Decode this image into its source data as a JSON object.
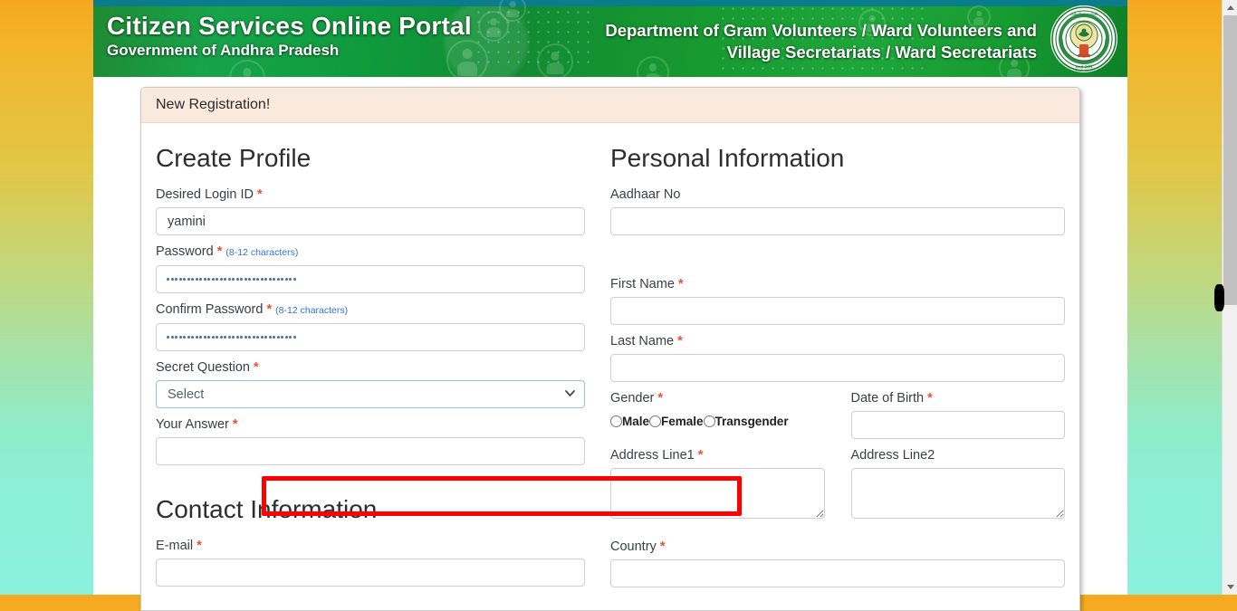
{
  "banner": {
    "title_line1": "Citizen Services Online Portal",
    "title_line2": "Government of Andhra Pradesh",
    "dept_line1": "Department of Gram Volunteers / Ward Volunteers and",
    "dept_line2": "Village Secretariats / Ward Secretariats",
    "emblem_name": "andhra-pradesh-state-emblem",
    "colors": {
      "green_dark": "#0f7f27",
      "green_mid": "#17a34a",
      "top_strip": "#0b7c8c"
    }
  },
  "panel": {
    "header_title": "New Registration!"
  },
  "create_profile": {
    "heading": "Create Profile",
    "fields": {
      "login_id": {
        "label": "Desired Login ID",
        "required": true,
        "value": "yamini",
        "placeholder": ""
      },
      "password": {
        "label": "Password",
        "required": true,
        "hint": "(8-12 characters)",
        "masked_value": "································",
        "mask_char_count": 32
      },
      "confirm_password": {
        "label": "Confirm Password",
        "required": true,
        "hint": "(8-12 characters)",
        "masked_value": "································",
        "mask_char_count": 32
      },
      "secret_question": {
        "label": "Secret Question",
        "required": true,
        "selected": "Select",
        "options": [
          "Select"
        ],
        "focused": true,
        "highlighted": true
      },
      "your_answer": {
        "label": "Your Answer",
        "required": true,
        "value": "",
        "placeholder": ""
      }
    }
  },
  "contact_information": {
    "heading": "Contact Information",
    "fields": {
      "email": {
        "label": "E-mail",
        "required": true,
        "value": "",
        "placeholder": ""
      }
    }
  },
  "personal_information": {
    "heading": "Personal Information",
    "fields": {
      "aadhaar_no": {
        "label": "Aadhaar No",
        "required": false,
        "value": "",
        "placeholder": ""
      },
      "first_name": {
        "label": "First Name",
        "required": true,
        "value": "",
        "placeholder": ""
      },
      "last_name": {
        "label": "Last Name",
        "required": true,
        "value": "",
        "placeholder": ""
      },
      "gender": {
        "label": "Gender",
        "required": true,
        "selected": null,
        "options": [
          {
            "label": "Male",
            "checked": false
          },
          {
            "label": "Female",
            "checked": false
          },
          {
            "label": "Transgender",
            "checked": false
          }
        ]
      },
      "date_of_birth": {
        "label": "Date of Birth",
        "required": true,
        "value": "",
        "placeholder": ""
      },
      "address_line1": {
        "label": "Address Line1",
        "required": true,
        "value": "",
        "placeholder": ""
      },
      "address_line2": {
        "label": "Address Line2",
        "required": false,
        "value": "",
        "placeholder": ""
      },
      "country": {
        "label": "Country",
        "required": true,
        "value": "",
        "placeholder": ""
      }
    }
  },
  "scrollbar": {
    "orientation": "vertical",
    "thumb_position": "top",
    "up_arrow": "scroll-up-arrow-icon",
    "down_arrow": "scroll-down-arrow-icon"
  },
  "highlight": {
    "color": "#ff0000",
    "target": "secret-question-select"
  },
  "required_marker": "*"
}
